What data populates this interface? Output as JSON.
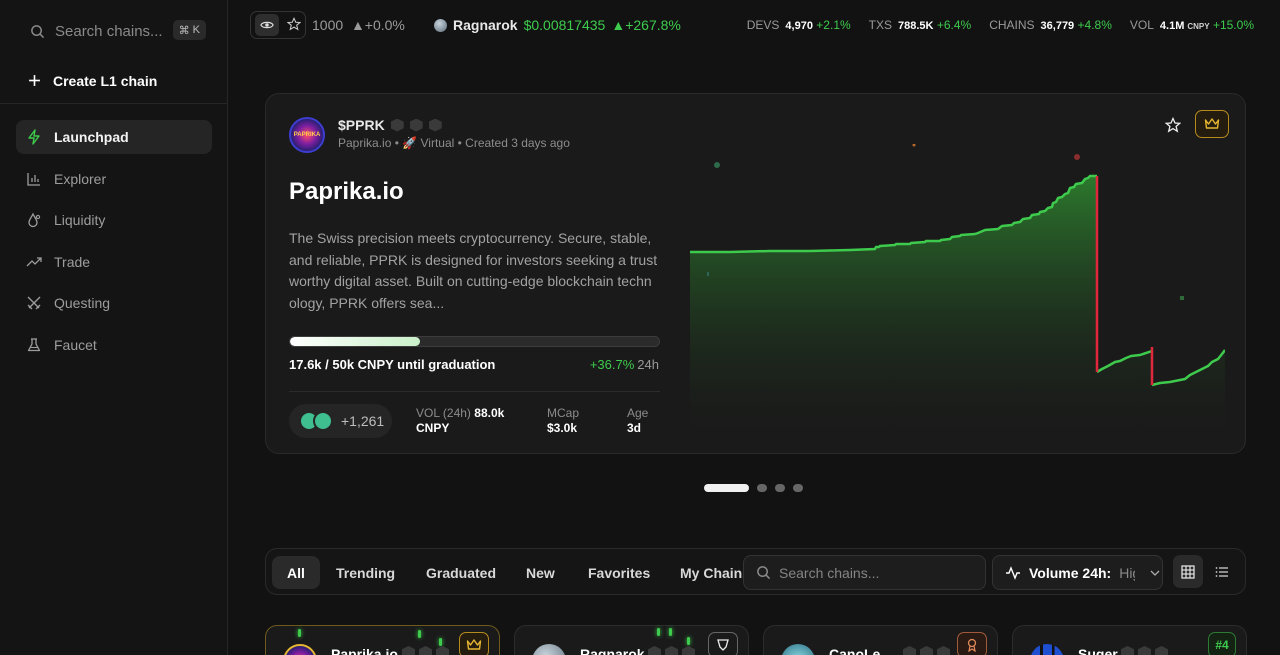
{
  "sidebar": {
    "search_placeholder": "Search chains...",
    "shortcut_symbol": "⌘",
    "shortcut_key": "K",
    "create_label": "Create L1 chain",
    "items": [
      {
        "label": "Launchpad",
        "icon": "bolt-icon",
        "active": true
      },
      {
        "label": "Explorer",
        "icon": "bar-chart-icon",
        "active": false
      },
      {
        "label": "Liquidity",
        "icon": "droplet-icon",
        "active": false
      },
      {
        "label": "Trade",
        "icon": "trend-icon",
        "active": false
      },
      {
        "label": "Questing",
        "icon": "swords-icon",
        "active": false
      },
      {
        "label": "Faucet",
        "icon": "flask-icon",
        "active": false
      }
    ]
  },
  "topbar": {
    "count": "1000",
    "count_change": "▲+0.0%",
    "token_name": "Ragnarok",
    "token_price": "$0.00817435",
    "token_change": "▲+267.8%",
    "stats": [
      {
        "label": "DEVS",
        "value": "4,970",
        "unit": "",
        "change": "+2.1%"
      },
      {
        "label": "TXS",
        "value": "788.5K",
        "unit": "",
        "change": "+6.4%"
      },
      {
        "label": "CHAINS",
        "value": "36,779",
        "unit": "",
        "change": "+4.8%"
      },
      {
        "label": "VOL",
        "value": "4.1M",
        "unit": "CNPY",
        "change": "+15.0%"
      }
    ]
  },
  "hero": {
    "avatar_text": "PAPRIKA",
    "symbol": "$PPRK",
    "meta": "Paprika.io • 🚀 Virtual • Created 3 days ago",
    "title": "Paprika.io",
    "description": "The Swiss precision meets cryptocurrency. Secure, stable, and reliable, PPRK is designed for investors seeking a trust worthy digital asset. Built on cutting-edge blockchain techn ology, PPRK offers sea...",
    "progress": 0.3534,
    "graduation": "17.6k / 50k CNPY until graduation",
    "change": "+36.7%",
    "change_period": "24h",
    "holders": "+1,261",
    "vol_label": "VOL (24h)",
    "vol_value": "88.0k",
    "vol_unit": "CNPY",
    "mcap_label": "MCap",
    "mcap_value": "$3.0k",
    "age_label": "Age",
    "age_value": "3d",
    "accent_green": "#3ecb4d",
    "accent_red": "#e0283c"
  },
  "filters": {
    "tabs": [
      "All",
      "Trending",
      "Graduated",
      "New",
      "Favorites",
      "My Chains"
    ],
    "search_placeholder": "Search chains...",
    "sort_label": "Volume 24h:",
    "sort_value": "High"
  },
  "cards": [
    {
      "name": "Paprika.io",
      "badge": "crown-icon"
    },
    {
      "name": "Ragnarok",
      "badge": "shield-icon"
    },
    {
      "name": "CanoLe",
      "badge": "award-icon"
    },
    {
      "name": "Suger",
      "badge": "#4"
    }
  ]
}
